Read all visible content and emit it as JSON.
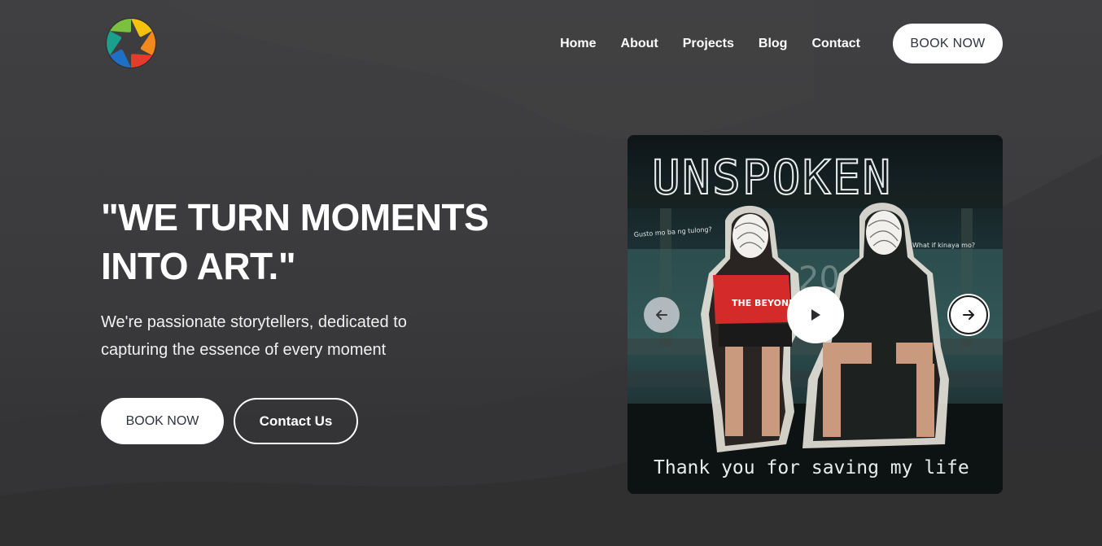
{
  "nav": {
    "logo_icon": "aperture-logo-icon",
    "items": [
      {
        "label": "Home"
      },
      {
        "label": "About"
      },
      {
        "label": "Projects"
      },
      {
        "label": "Blog"
      },
      {
        "label": "Contact"
      }
    ],
    "cta_label": "BOOK NOW"
  },
  "hero": {
    "headline_line1": "\"WE TURN MOMENTS",
    "headline_line2": "INTO ART.\"",
    "subtitle": "We're passionate storytellers, dedicated to capturing the essence of every moment",
    "primary_button": "BOOK NOW",
    "secondary_button": "Contact Us"
  },
  "media": {
    "photo_title": "UNSPOKEN",
    "photo_caption": "Thank you for saving my life",
    "note_left": "Gusto mo ba ng tulong?",
    "note_right": "What if kinaya mo?",
    "shirt_text": "THE BEYOND",
    "controls": {
      "prev_icon": "arrow-left-icon",
      "play_icon": "play-icon",
      "next_icon": "arrow-right-icon"
    }
  },
  "colors": {
    "background": "#3d3d3f",
    "button_text": "#2e3340",
    "white": "#ffffff"
  }
}
